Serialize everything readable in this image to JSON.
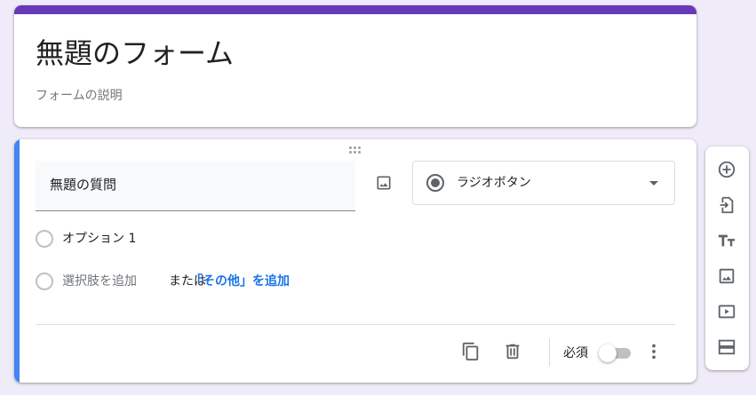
{
  "form": {
    "title": "無題のフォーム",
    "description_placeholder": "フォームの説明"
  },
  "question": {
    "title": "無題の質問",
    "type_label": "ラジオボタン",
    "options": [
      {
        "label": "オプション 1"
      }
    ],
    "add_option_text": "選択肢を追加",
    "or_text": "または",
    "add_other_text": "「その他」を追加",
    "required_label": "必須",
    "required_on": false
  },
  "colors": {
    "accent": "#673ab7",
    "active_bar": "#4285f4",
    "link": "#1a73e8",
    "background": "#f0ebf8"
  },
  "side_toolbar": {
    "tools": [
      "add-circle-icon",
      "import-icon",
      "title-text-icon",
      "image-icon",
      "video-icon",
      "section-icon"
    ]
  }
}
